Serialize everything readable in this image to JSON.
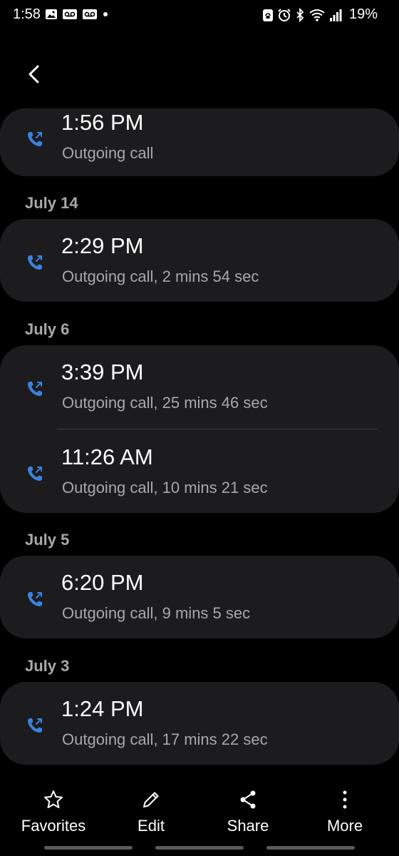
{
  "status_bar": {
    "time": "1:58",
    "battery": "19%",
    "left_icons": [
      "gallery-icon",
      "voicemail-icon",
      "voicemail-icon",
      "dot-icon"
    ],
    "right_icons": [
      "lock-rotation-icon",
      "alarm-icon",
      "bluetooth-icon",
      "wifi-icon",
      "signal-icon"
    ]
  },
  "header": {
    "back_icon": "chevron-left-icon"
  },
  "call_log": {
    "accent_color": "#3b82e0",
    "groups": [
      {
        "date": "",
        "entries": [
          {
            "time": "1:56 PM",
            "detail": "Outgoing call"
          }
        ]
      },
      {
        "date": "July 14",
        "entries": [
          {
            "time": "2:29 PM",
            "detail": "Outgoing call, 2 mins 54 sec"
          }
        ]
      },
      {
        "date": "July 6",
        "entries": [
          {
            "time": "3:39 PM",
            "detail": "Outgoing call, 25 mins 46 sec"
          },
          {
            "time": "11:26 AM",
            "detail": "Outgoing call, 10 mins 21 sec"
          }
        ]
      },
      {
        "date": "July 5",
        "entries": [
          {
            "time": "6:20 PM",
            "detail": "Outgoing call, 9 mins 5 sec"
          }
        ]
      },
      {
        "date": "July 3",
        "entries": [
          {
            "time": "1:24 PM",
            "detail": "Outgoing call, 17 mins 22 sec"
          }
        ]
      }
    ]
  },
  "toolbar": {
    "favorites_label": "Favorites",
    "edit_label": "Edit",
    "share_label": "Share",
    "more_label": "More"
  }
}
